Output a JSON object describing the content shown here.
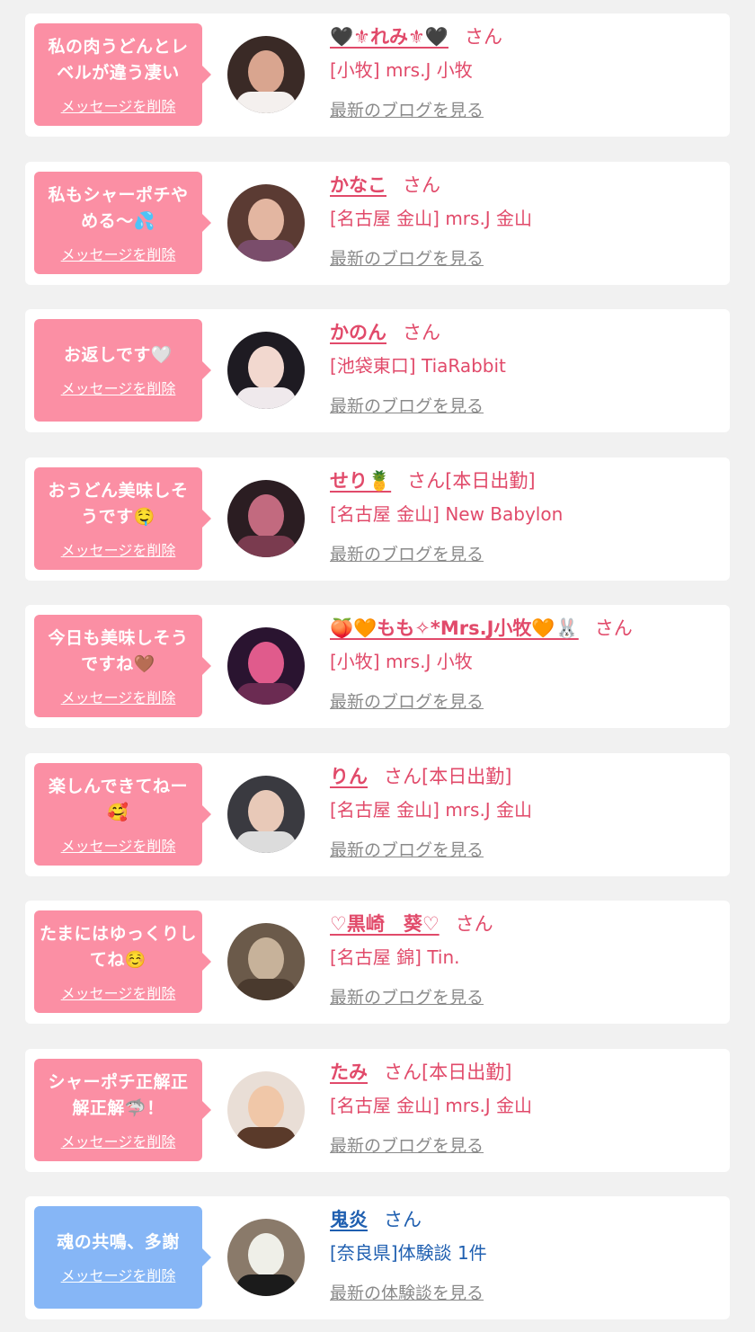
{
  "messages": [
    {
      "name": "🖤⚜れみ⚜🖤",
      "honorific": "さん",
      "shop": "[小牧] mrs.J 小牧",
      "message": "私の肉うどんとレベルが違う凄い",
      "delete_label": "メッセージを削除",
      "blog_label": "最新のブログを見る",
      "color": "#fb8fa4",
      "theme": "pink"
    },
    {
      "name": "かなこ",
      "honorific": "さん",
      "shop": "[名古屋 金山] mrs.J 金山",
      "message": "私もシャーポチやめる〜💦",
      "delete_label": "メッセージを削除",
      "blog_label": "最新のブログを見る",
      "color": "#fb8fa4",
      "theme": "pink"
    },
    {
      "name": "かのん",
      "honorific": "さん",
      "shop": "[池袋東口] TiaRabbit",
      "message": "お返しです🤍",
      "delete_label": "メッセージを削除",
      "blog_label": "最新のブログを見る",
      "color": "#fb8fa4",
      "theme": "pink"
    },
    {
      "name": "せり🍍",
      "honorific": "さん[本日出勤]",
      "shop": "[名古屋 金山] New Babylon",
      "message": "おうどん美味しそうです🤤",
      "delete_label": "メッセージを削除",
      "blog_label": "最新のブログを見る",
      "color": "#fb8fa4",
      "theme": "pink"
    },
    {
      "name": "🍑🧡もも✧*Mrs.J小牧🧡🐰",
      "honorific": "さん",
      "shop": "[小牧] mrs.J 小牧",
      "message": "今日も美味しそうですね🤎",
      "delete_label": "メッセージを削除",
      "blog_label": "最新のブログを見る",
      "color": "#fb8fa4",
      "theme": "pink"
    },
    {
      "name": "りん",
      "honorific": "さん[本日出勤]",
      "shop": "[名古屋 金山] mrs.J 金山",
      "message": "楽しんできてねー🥰",
      "delete_label": "メッセージを削除",
      "blog_label": "最新のブログを見る",
      "color": "#fb8fa4",
      "theme": "pink"
    },
    {
      "name": "♡黒崎　葵♡",
      "honorific": "さん",
      "shop": "[名古屋 錦] Tin.",
      "message": "たまにはゆっくりしてね☺️",
      "delete_label": "メッセージを削除",
      "blog_label": "最新のブログを見る",
      "color": "#fb8fa4",
      "theme": "pink"
    },
    {
      "name": "たみ",
      "honorific": "さん[本日出勤]",
      "shop": "[名古屋 金山] mrs.J 金山",
      "message": "シャーポチ正解正解正解🦈！",
      "delete_label": "メッセージを削除",
      "blog_label": "最新のブログを見る",
      "color": "#fb8fa4",
      "theme": "pink"
    },
    {
      "name": "鬼炎",
      "honorific": "さん",
      "shop": "[奈良県]体験談 1件",
      "message": "魂の共鳴、多謝",
      "delete_label": "メッセージを削除",
      "blog_label": "最新の体験談を見る",
      "color": "#86b6f6",
      "theme": "blue"
    }
  ]
}
